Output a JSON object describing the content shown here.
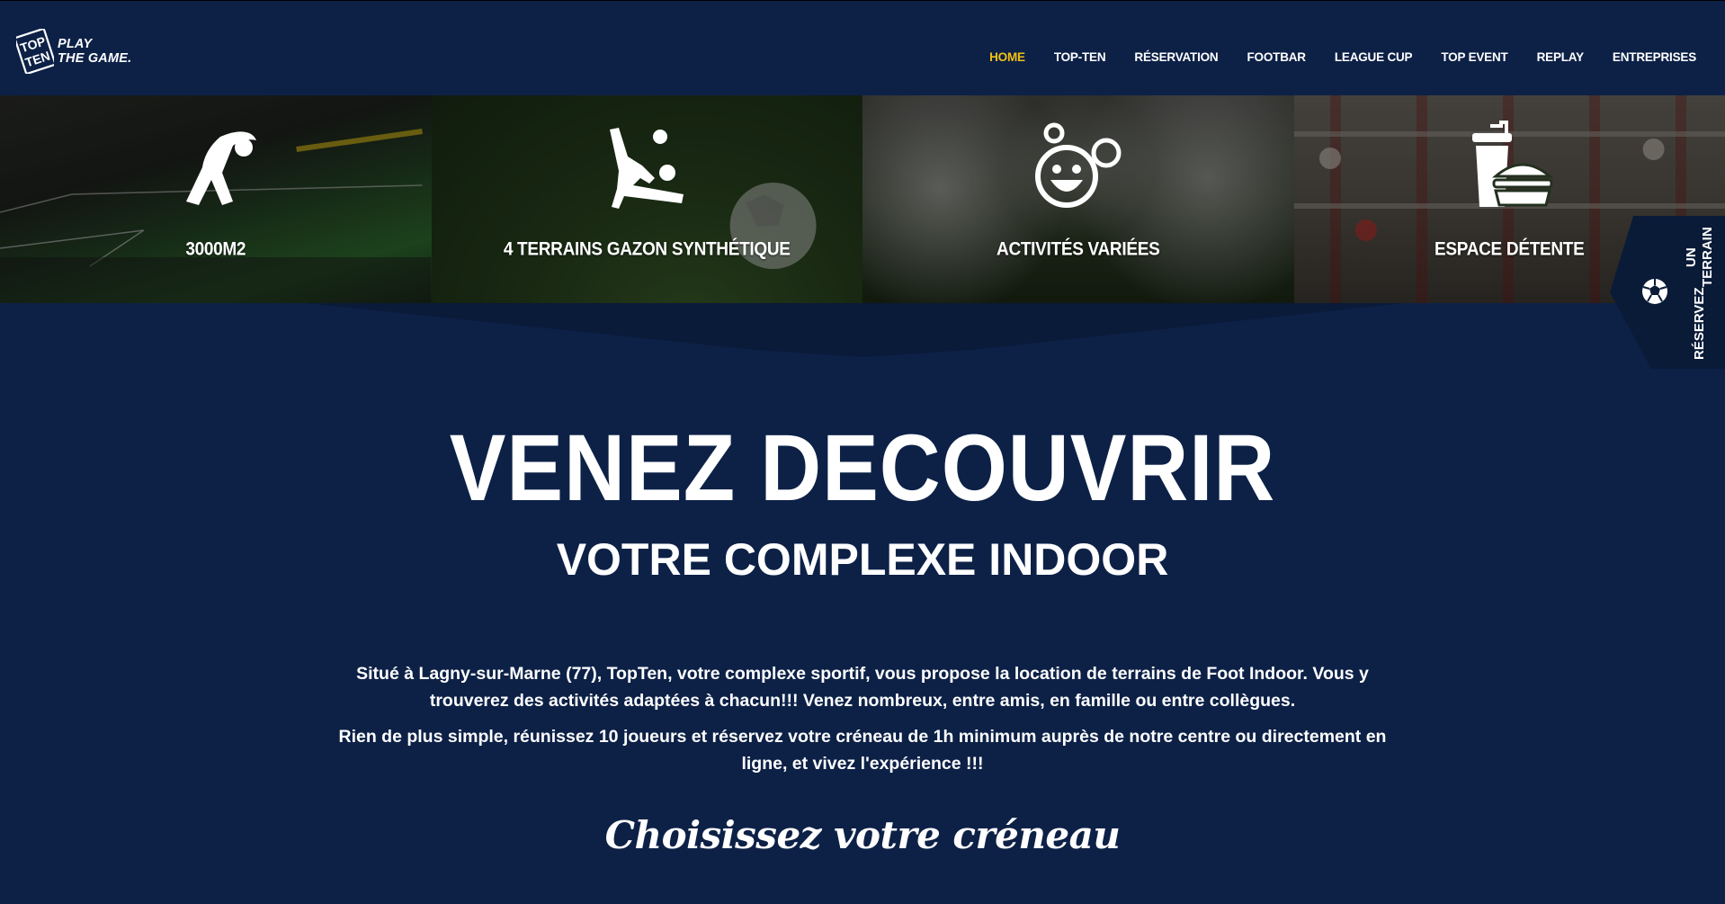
{
  "brand": {
    "logo_letters": [
      "TOP",
      "TEN"
    ],
    "tagline_line1": "PLAY",
    "tagline_line2": "THE GAME."
  },
  "nav": {
    "items": [
      {
        "label": "HOME",
        "active": true
      },
      {
        "label": "TOP-TEN",
        "active": false
      },
      {
        "label": "RÉSERVATION",
        "active": false
      },
      {
        "label": "FOOTBAR",
        "active": false
      },
      {
        "label": "LEAGUE CUP",
        "active": false
      },
      {
        "label": "TOP EVENT",
        "active": false
      },
      {
        "label": "REPLAY",
        "active": false
      },
      {
        "label": "ENTREPRISES",
        "active": false
      }
    ]
  },
  "features": [
    {
      "label": "3000M2",
      "icon": "stretching-person-icon"
    },
    {
      "label": "4 TERRAINS GAZON SYNTHÉTIQUE",
      "icon": "bicycle-kick-icon"
    },
    {
      "label": "ACTIVITÉS VARIÉES",
      "icon": "smiley-bubbles-icon"
    },
    {
      "label": "ESPACE DÉTENTE",
      "icon": "drink-burger-icon"
    }
  ],
  "reserve_tab": {
    "line1": "RÉSERVEZ",
    "line2": "UN TERRAIN"
  },
  "hero": {
    "title": "VENEZ DECOUVRIR",
    "subtitle": "VOTRE COMPLEXE INDOOR",
    "paragraph1": "Situé à Lagny-sur-Marne (77), TopTen, votre complexe sportif, vous propose la location de terrains de Foot Indoor. Vous y trouverez des activités adaptées à chacun!!! Venez nombreux, entre amis, en famille ou entre collègues.",
    "paragraph2": "Rien de plus simple, réunissez 10 joueurs et réservez votre créneau de 1h minimum auprès de notre centre ou directement en ligne, et vivez l'expérience !!!",
    "script_title": "Choisissez votre créneau"
  },
  "colors": {
    "background": "#0d2147",
    "accent": "#f2c012",
    "tab": "#0a1b38"
  }
}
